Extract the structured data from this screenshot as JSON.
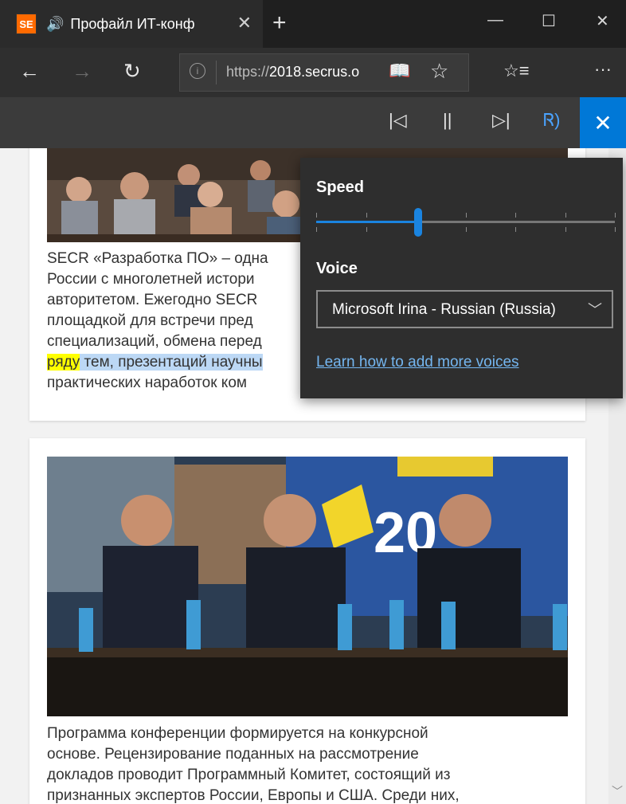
{
  "tab": {
    "favicon_text": "SE",
    "title": "Профайл ИТ-конф",
    "close_glyph": "✕",
    "new_tab_glyph": "+"
  },
  "window": {
    "minimize_glyph": "—",
    "maximize_glyph": "☐",
    "close_glyph": "✕"
  },
  "nav": {
    "back_glyph": "←",
    "forward_glyph": "→",
    "refresh_glyph": "↻",
    "address": {
      "info_glyph": "i",
      "protocol": "https://",
      "host": "2018.secrus.o",
      "reading_view_glyph": "📖",
      "favorite_glyph": "☆"
    },
    "favorites_glyph": "☆≡",
    "more_glyph": "···"
  },
  "read_aloud": {
    "prev_glyph": "|◁",
    "pause_glyph": "||",
    "next_glyph": "▷|",
    "voice_glyph": "Ꮢ)",
    "close_glyph": "✕"
  },
  "settings_panel": {
    "speed_label": "Speed",
    "speed_level": 0.34,
    "voice_label": "Voice",
    "voice_value": "Microsoft Irina - Russian (Russia)",
    "learn_link": "Learn how to add more voices"
  },
  "article": {
    "paragraph1": {
      "lines": [
        "SECR «Разработка ПО» – одна",
        "России с многолетней истори",
        "авторитетом. Ежегодно SECR",
        "площадкой для встречи пред",
        "специализаций, обмена перед"
      ],
      "highlight_word": "ряду",
      "highlight_rest": " тем, презентаций научны",
      "last_line": "практических наработок ком"
    },
    "paragraph2": [
      "Программа конференции формируется на конкурсной",
      "основе. Рецензирование поданных на рассмотрение",
      "докладов проводит Программный Комитет, состоящий из",
      "признанных экспертов России, Европы и США. Среди них,"
    ],
    "banner_text": "20"
  },
  "colors": {
    "accent": "#0078d7",
    "highlight_word": "#ffff00",
    "highlight_sentence": "#bcd8f5",
    "link": "#74b6f0"
  }
}
